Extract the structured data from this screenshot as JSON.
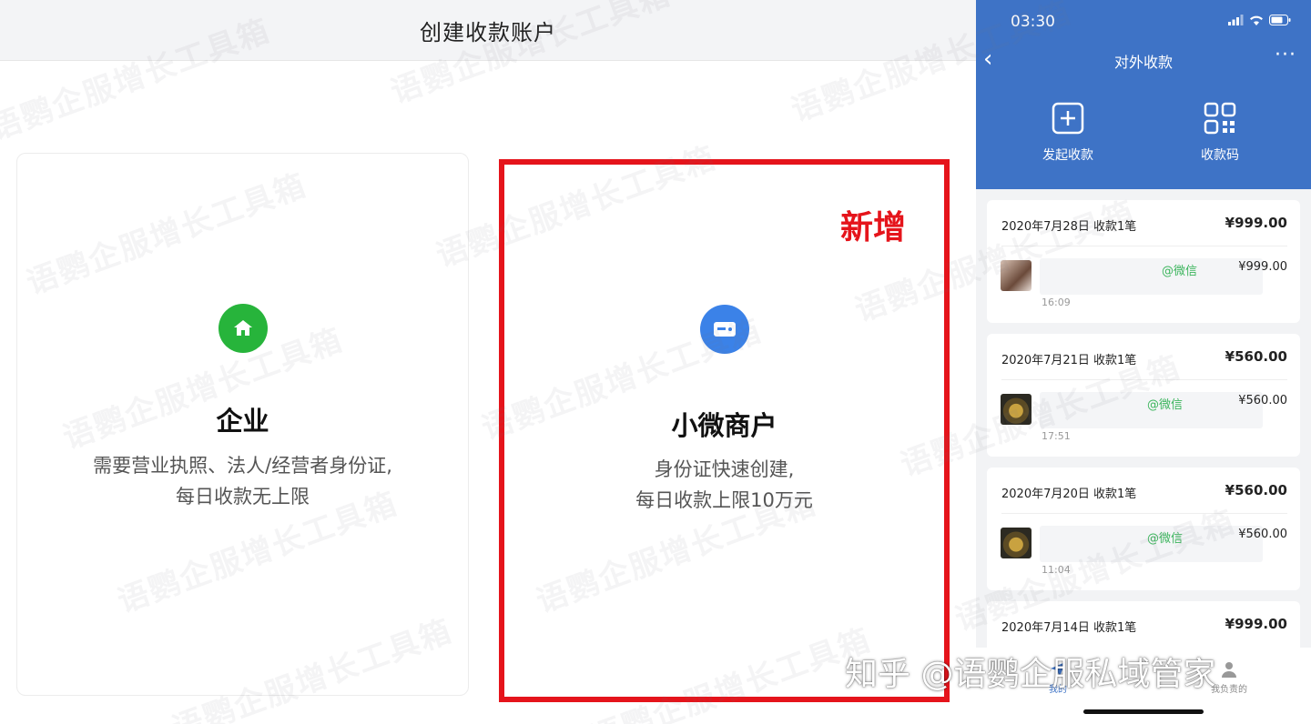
{
  "left_panel": {
    "title": "创建收款账户",
    "cards": [
      {
        "title": "企业",
        "desc_line1": "需要营业执照、法人/经营者身份证,",
        "desc_line2": "每日收款无上限",
        "icon": "home-icon",
        "icon_color": "#27b43b"
      },
      {
        "title": "小微商户",
        "desc_line1": "身份证快速创建,",
        "desc_line2": "每日收款上限10万元",
        "icon": "card-icon",
        "icon_color": "#3b82e8",
        "tag": "新增",
        "highlight_color": "#e5141b"
      }
    ]
  },
  "phone": {
    "status_time": "03:30",
    "nav_title": "对外收款",
    "nav_more": "···",
    "accent_color": "#3e73c6",
    "actions": [
      {
        "label": "发起收款",
        "icon": "plus-square-icon"
      },
      {
        "label": "收款码",
        "icon": "qr-code-icon"
      }
    ],
    "records": [
      {
        "date": "2020年7月28日 收款1笔",
        "total": "¥999.00",
        "via": "@微信",
        "amount": "¥999.00",
        "time": "16:09"
      },
      {
        "date": "2020年7月21日 收款1笔",
        "total": "¥560.00",
        "via": "@微信",
        "amount": "¥560.00",
        "time": "17:51"
      },
      {
        "date": "2020年7月20日 收款1笔",
        "total": "¥560.00",
        "via": "@微信",
        "amount": "¥560.00",
        "time": "11:04"
      },
      {
        "date": "2020年7月14日 收款1笔",
        "total": "¥999.00"
      }
    ],
    "tabs": [
      {
        "label": "我的"
      },
      {
        "label": "我负责的"
      }
    ]
  },
  "watermark_text": "语鹦企服增长工具箱",
  "credit": "知乎 @语鹦企服私域管家"
}
